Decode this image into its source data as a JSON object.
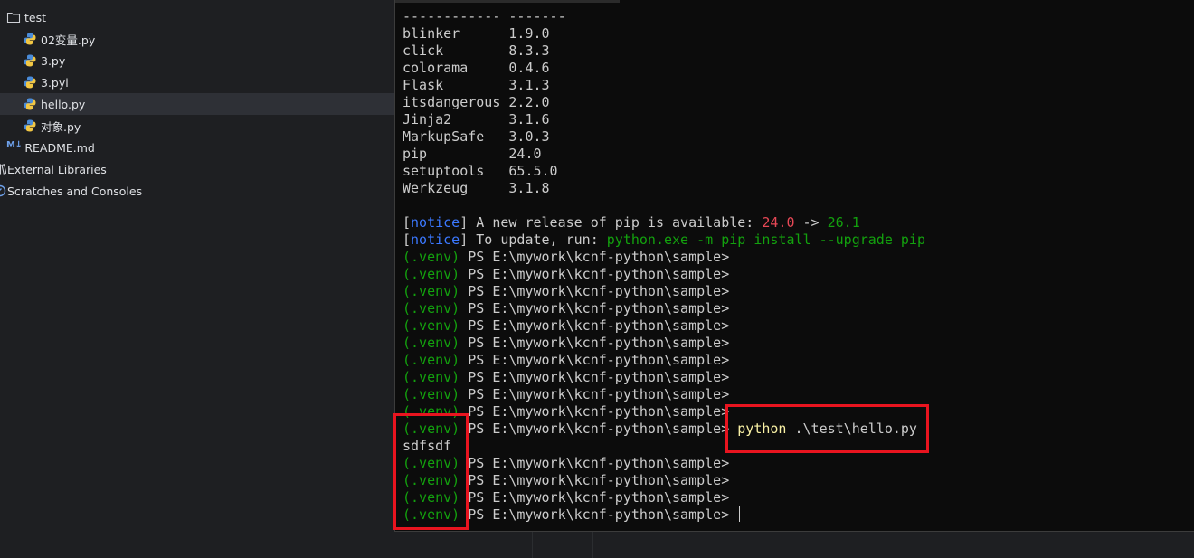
{
  "project_tree": {
    "items": [
      {
        "label": "test",
        "icon": "folder-icon"
      },
      {
        "label": "02变量.py",
        "icon": "python-file-icon"
      },
      {
        "label": "3.py",
        "icon": "python-file-icon"
      },
      {
        "label": "3.pyi",
        "icon": "python-file-icon"
      },
      {
        "label": "hello.py",
        "icon": "python-file-icon",
        "selected": true
      },
      {
        "label": "对象.py",
        "icon": "python-file-icon"
      },
      {
        "label": "README.md",
        "icon": "markdown-icon",
        "icon_text": "M↓"
      },
      {
        "label": "External Libraries",
        "icon": "library-icon"
      },
      {
        "label": "Scratches and Consoles",
        "icon": "scratches-icon"
      }
    ]
  },
  "terminal": {
    "separator": "------------ -------",
    "packages": [
      {
        "name": "blinker",
        "version": "1.9.0"
      },
      {
        "name": "click",
        "version": "8.3.3"
      },
      {
        "name": "colorama",
        "version": "0.4.6"
      },
      {
        "name": "Flask",
        "version": "3.1.3"
      },
      {
        "name": "itsdangerous",
        "version": "2.2.0"
      },
      {
        "name": "Jinja2",
        "version": "3.1.6"
      },
      {
        "name": "MarkupSafe",
        "version": "3.0.3"
      },
      {
        "name": "pip",
        "version": "24.0"
      },
      {
        "name": "setuptools",
        "version": "65.5.0"
      },
      {
        "name": "Werkzeug",
        "version": "3.1.8"
      }
    ],
    "notice_tag": "notice",
    "notice1_text": "A new release of pip is available:",
    "notice1_old": "24.0",
    "notice1_arrow": "->",
    "notice1_new": "26.1",
    "notice2_text": "To update, run:",
    "notice2_cmd": "python.exe -m pip install --upgrade pip",
    "venv": "(.venv)",
    "prompt": "PS E:\\mywork\\kcnf-python\\sample>",
    "command_exe": "python",
    "command_arg": ".\\test\\hello.py",
    "output": "sdfsdf",
    "prompts_before": 10,
    "prompts_after": 4
  },
  "colors": {
    "notice": "#3b78ff",
    "old_version": "#e74856",
    "new_version": "#13a10e",
    "venv": "#13a10e",
    "command": "#f9f1a5",
    "highlight": "#e8141f"
  }
}
